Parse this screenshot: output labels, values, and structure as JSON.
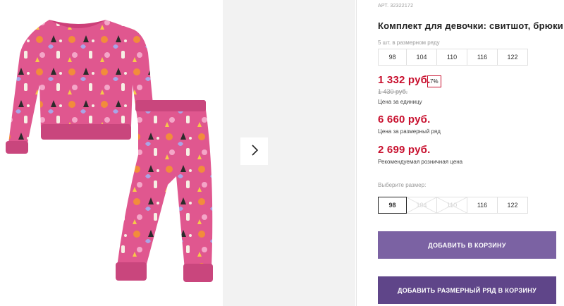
{
  "product": {
    "sku": "АРТ. 32322172",
    "title": "Комплект для девочки: свитшот, брюки"
  },
  "pack": {
    "label": "5 шт. в размерном ряду",
    "sizes": [
      "98",
      "104",
      "110",
      "116",
      "122"
    ]
  },
  "prices": {
    "unit_price": "1 332 руб.",
    "discount": "7%",
    "old_price": "1 430 руб.",
    "unit_caption": "Цена за единицу",
    "pack_price": "6 660 руб.",
    "pack_caption": "Цена за размерный ряд",
    "retail_price": "2 699 руб.",
    "retail_caption": "Рекомендуемая розничная цена"
  },
  "size_select": {
    "label": "Выберите размер:",
    "sizes": [
      "98",
      "104",
      "110",
      "116",
      "122"
    ],
    "selected": "98",
    "unavailable": [
      "104",
      "110"
    ]
  },
  "actions": {
    "add_to_cart": "ДОБАВИТЬ В КОРЗИНУ",
    "add_pack_to_cart": "ДОБАВИТЬ РАЗМЕРНЫЙ РЯД В КОРЗИНУ"
  },
  "colors": {
    "price_red": "#c8102e",
    "button_primary": "#7b62a3",
    "button_dark": "#5f4589",
    "garment_pink": "#e0578f"
  },
  "icons": {
    "next": "chevron-right-icon"
  }
}
